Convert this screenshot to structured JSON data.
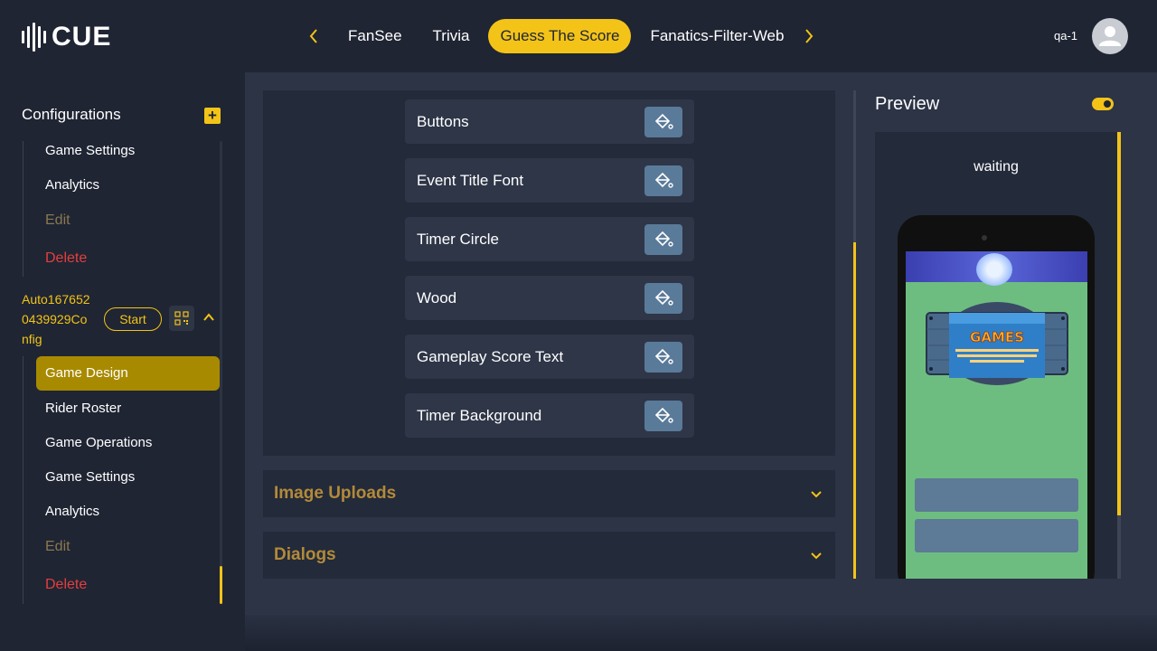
{
  "header": {
    "logo_text": "CUE",
    "tabs": [
      {
        "label": "FanSee"
      },
      {
        "label": "Trivia"
      },
      {
        "label": "Guess The Score"
      },
      {
        "label": "Fanatics-Filter-Web"
      }
    ],
    "active_tab": "Guess The Score",
    "user": "qa-1"
  },
  "sidebar": {
    "title": "Configurations",
    "first_config_items": [
      {
        "label": "Game Settings"
      },
      {
        "label": "Analytics"
      },
      {
        "label": "Edit"
      },
      {
        "label": "Delete"
      }
    ],
    "config_name": "Auto1676520439929Config",
    "config_name_lines": [
      "Auto167652",
      "0439929Co",
      "nfig"
    ],
    "start_label": "Start",
    "config_items": [
      {
        "label": "Game Design"
      },
      {
        "label": "Rider Roster"
      },
      {
        "label": "Game Operations"
      },
      {
        "label": "Game Settings"
      },
      {
        "label": "Analytics"
      },
      {
        "label": "Edit"
      },
      {
        "label": "Delete"
      }
    ],
    "active_item": "Game Design"
  },
  "colors_section": {
    "rows": [
      {
        "label": "Buttons"
      },
      {
        "label": "Event Title Font"
      },
      {
        "label": "Timer Circle"
      },
      {
        "label": "Wood"
      },
      {
        "label": "Gameplay Score Text"
      },
      {
        "label": "Timer Background"
      }
    ]
  },
  "accordions": [
    {
      "label": "Image Uploads"
    },
    {
      "label": "Dialogs"
    }
  ],
  "preview": {
    "title": "Preview",
    "status": "waiting",
    "toggle_on": true
  },
  "colors": {
    "accent": "#f3c318",
    "background": "#1f2533",
    "panel": "#232a39",
    "delete": "#e53e3e",
    "swatch": "#5a7a99",
    "phone_bg": "#6dbd80"
  }
}
